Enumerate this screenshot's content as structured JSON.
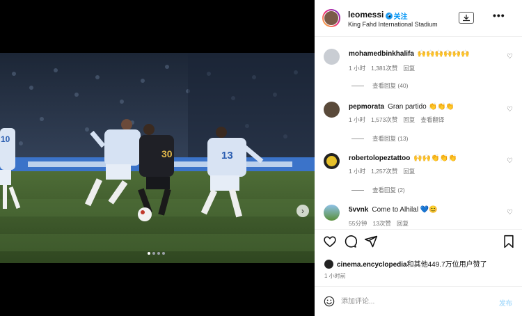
{
  "post": {
    "username": "leomessi",
    "follow_label": "关注",
    "location": "King Fahd International Stadium"
  },
  "media": {
    "jersey_numbers": [
      "30",
      "13",
      "10"
    ],
    "carousel_count": 4,
    "carousel_active": 1
  },
  "comments": [
    {
      "user": "mohamedbinkhalifa",
      "text": "🙌🙌🙌🙌🙌🙌",
      "time": "1 小时",
      "likes": "1,381次赞",
      "reply_label": "回复",
      "translate": "",
      "view_replies": "查看回复 (40)"
    },
    {
      "user": "pepmorata",
      "text": "Gran partido 👏👏👏",
      "time": "1 小时",
      "likes": "1,573次赞",
      "reply_label": "回复",
      "translate": "查看翻译",
      "view_replies": "查看回复 (13)"
    },
    {
      "user": "robertolopeztattoo",
      "text": "🙌🙌👏👏👏",
      "time": "1 小时",
      "likes": "1,257次赞",
      "reply_label": "回复",
      "translate": "",
      "view_replies": "查看回复 (2)"
    },
    {
      "user": "5vvnk",
      "text": "Come to Alhilal 💙😊",
      "time": "55分钟",
      "likes": "13次赞",
      "reply_label": "回复",
      "translate": "",
      "view_replies": ""
    }
  ],
  "likes_line": {
    "user": "cinema.encyclopedia",
    "suffix": "和其他449.7万位用户赞了"
  },
  "time_ago": "1 小时前",
  "composer": {
    "placeholder": "添加评论...",
    "post_label": "发布"
  },
  "icons": [
    "download-icon",
    "more-icon",
    "heart-icon",
    "comment-icon",
    "share-icon",
    "bookmark-icon",
    "emoji-icon",
    "verified-icon",
    "chevron-right-icon"
  ],
  "colors": {
    "link": "#0095f6",
    "verified": "#1d9bf0",
    "post_disabled": "#b2dffc"
  }
}
